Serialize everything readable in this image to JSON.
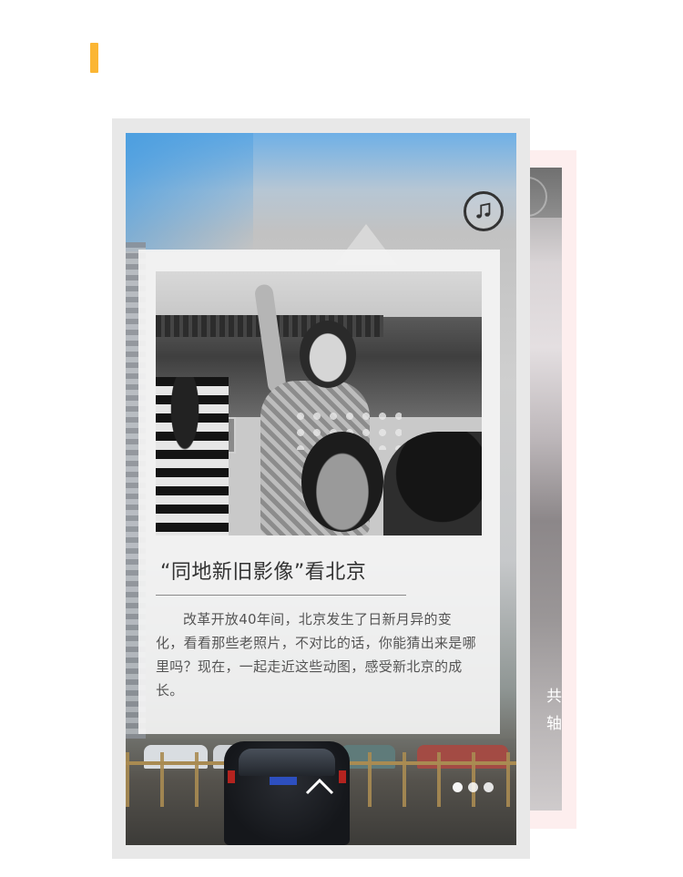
{
  "colors": {
    "accent": "#fbb634",
    "back_card": "#fdeeee",
    "frame": "#e8e8e8",
    "panel": "#f4f4f4",
    "title_text": "#333333",
    "body_text": "#555555"
  },
  "article": {
    "title": "“同地新旧影像”看北京",
    "body": "改革开放40年间，北京发生了日新月异的变化，看看那些老照片，不对比的话，你能猜出来是哪里吗？现在，一起走近这些动图，感受新北京的成长。"
  },
  "next_card": {
    "peek_text_line1": "共",
    "peek_text_line2": "轴"
  },
  "icons": {
    "music": "music-note-icon",
    "scroll": "chevron-up-icon"
  },
  "pager": {
    "count": 3,
    "active_index": 0
  }
}
